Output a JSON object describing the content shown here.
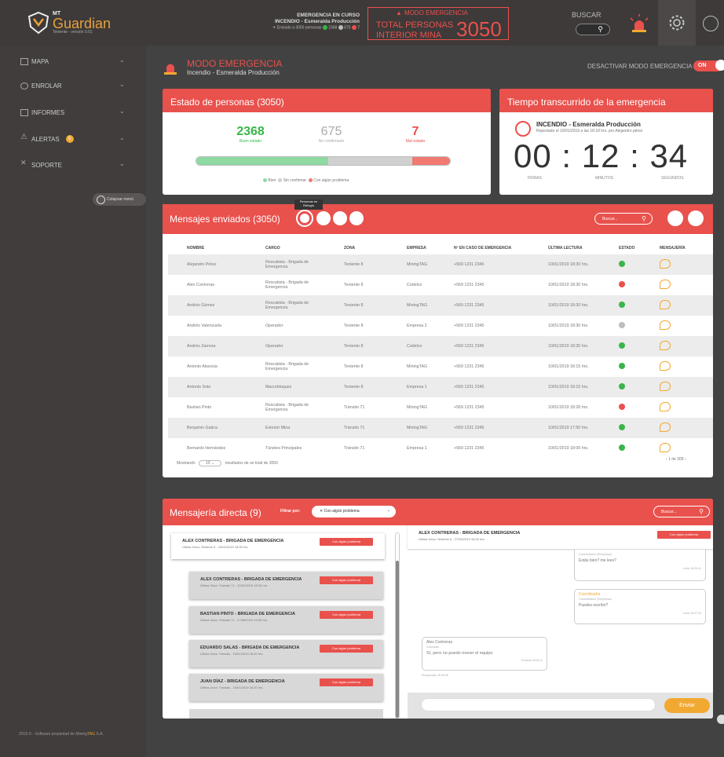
{
  "header": {
    "logo_mt": "MT",
    "logo_name": "Guardian",
    "logo_version": "Teniente - versión 0.01",
    "emergency_status": "EMERGENCIA EN CURSO",
    "emergency_name": "INCENDIO - Esmeralda Producción",
    "sent_text": "Enviado a 3050 personas",
    "count_good": "2368",
    "count_unconfirmed": "675",
    "count_bad": "7",
    "mode_label": "MODO EMERGENCIA",
    "total_line1": "TOTAL PERSONAS",
    "total_line2": "INTERIOR MINA",
    "total_number": "3050",
    "search_label": "BUSCAR"
  },
  "sidebar": {
    "items": [
      {
        "label": "MAPA"
      },
      {
        "label": "ENROLAR"
      },
      {
        "label": "INFORMES"
      },
      {
        "label": "ALERTAS",
        "badge": "5"
      },
      {
        "label": "SOPORTE"
      }
    ],
    "collapse_label": "Colapsar menú",
    "footer_prefix": "2019 © - Software propiedad de Mining",
    "footer_brand": "TAG",
    "footer_suffix": "S.A."
  },
  "mode": {
    "title": "MODO EMERGENCIA",
    "subtitle": "Incendio - Esmeralda Producción",
    "deactivate_label": "DESACTIVAR MODO EMERGENCIA",
    "toggle_label": "ON"
  },
  "estado": {
    "title": "Estado de personas (3050)",
    "good_value": "2368",
    "good_label": "Buen estado",
    "unconfirmed_value": "675",
    "unconfirmed_label": "No confirmado",
    "bad_value": "7",
    "bad_label": "Mal estado",
    "legend_good": "Bien",
    "legend_unconfirmed": "Sin confirmar",
    "legend_bad": "Con algún problema",
    "bar_fractions": {
      "good": 0.52,
      "unconfirmed": 0.33,
      "bad": 0.15
    },
    "colors": {
      "good": "#8fd9a3",
      "unconfirmed": "#d0d0d0",
      "bad": "#f07a72"
    }
  },
  "tiempo": {
    "title": "Tiempo transcurrido de la emergencia",
    "event_title": "INCENDIO - Esmeralda Producción",
    "event_sub": "Reportado el 10/01/2019 a las 18:18 hrs. por Alejandro pérez",
    "timer": "00 : 12 : 34",
    "label_hours": "HORAS",
    "label_minutes": "MINUTOS",
    "label_seconds": "SEGUNDOS"
  },
  "messages": {
    "title": "Mensajes enviados (3050)",
    "tooltip": "Personas en Refugio",
    "search_placeholder": "Buscar...",
    "columns": [
      "NOMBRE",
      "CARGO",
      "ZONA",
      "EMPRESA",
      "Nº EN CASO DE EMERGENCIA",
      "ÚLTIMA LECTURA",
      "ESTADO",
      "MENSAJERÍA"
    ],
    "rows": [
      {
        "nombre": "Alejandro Pérez",
        "cargo": "Rescatista - Brigada de Emergencia",
        "zona": "Teniente 8",
        "empresa": "MiningTAG",
        "tel": "+569 1231 2345",
        "lectura": "10/01/2019 18:30 hrs.",
        "estado": "ok"
      },
      {
        "nombre": "Alex Contreras",
        "cargo": "Rescatista - Brigada de Emergencia",
        "zona": "Teniente 8",
        "empresa": "Codelco",
        "tel": "+569 1231 2345",
        "lectura": "10/01/2019 18:30 hrs.",
        "estado": "bad"
      },
      {
        "nombre": "Andrés Gómez",
        "cargo": "Rescatista - Brigada de Emergencia",
        "zona": "Teniente 8",
        "empresa": "MiningTAG",
        "tel": "+569 1231 2345",
        "lectura": "10/01/2019 18:30 hrs.",
        "estado": "ok"
      },
      {
        "nombre": "Andrés Valenzuela",
        "cargo": "Operador",
        "zona": "Teniente 8",
        "empresa": "Empresa 2",
        "tel": "+569 1231 2345",
        "lectura": "10/01/2019 18:30 hrs.",
        "estado": "none"
      },
      {
        "nombre": "Andrés Zamora",
        "cargo": "Operador",
        "zona": "Teniente 8",
        "empresa": "Codelco",
        "tel": "+569 1231 2345",
        "lectura": "10/01/2019 18:30 hrs.",
        "estado": "ok"
      },
      {
        "nombre": "Antonio Abarzúa",
        "cargo": "Rescatista - Brigada de Emergencia",
        "zona": "Teniente 8",
        "empresa": "MiningTAG",
        "tel": "+569 1231 2345",
        "lectura": "10/01/2019 18:15 hrs.",
        "estado": "ok"
      },
      {
        "nombre": "Antonio Soto",
        "cargo": "Macrobloques",
        "zona": "Teniente 8",
        "empresa": "Empresa 1",
        "tel": "+569 1231 2345",
        "lectura": "10/01/2019 18:15 hrs.",
        "estado": "ok"
      },
      {
        "nombre": "Bastian Pinto",
        "cargo": "Rescatista - Brigada de Emergencia",
        "zona": "Tránsito 71",
        "empresa": "MiningTAG",
        "tel": "+569 1231 2345",
        "lectura": "10/01/2019 18:28 hrs.",
        "estado": "bad"
      },
      {
        "nombre": "Benjamin Gatica",
        "cargo": "Exterior Mina",
        "zona": "Tránsito 71",
        "empresa": "MiningTAG",
        "tel": "+569 1231 2345",
        "lectura": "10/01/2019 17:50 hrs.",
        "estado": "ok"
      },
      {
        "nombre": "Bernardo Hernández",
        "cargo": "Túneles Principales",
        "zona": "Tránsito 71",
        "empresa": "Empresa 1",
        "tel": "+569 1231 2345",
        "lectura": "10/01/2019 18:00 hrs.",
        "estado": "ok"
      }
    ],
    "showing_prefix": "Mostrando",
    "page_size": "10",
    "showing_suffix": "resultados de un total de 3050",
    "pagination": "1 de 305",
    "status_colors": {
      "ok": "#3ab54a",
      "bad": "#e9514d",
      "none": "#bdbdbd"
    }
  },
  "direct": {
    "title": "Mensajería directa (9)",
    "filter_label": "Filtrar por:",
    "filter_value": "Con algún problema",
    "search_placeholder": "Buscar...",
    "conversations": [
      {
        "name": "ALEX CONTRERAS - BRIGADA DE EMERGENCIA",
        "zone": "Última Zona: Teniente 8 - 10/01/2019 18:30 hrs.",
        "badge": "Con algún problema"
      },
      {
        "name": "ALEX CONTRERAS - BRIGADA DE EMERGENCIA",
        "zone": "Última Zona: Tránsito 71 - 10/01/2019 18:30 hrs.",
        "badge": "Con algún problema"
      },
      {
        "name": "BASTIAN PINTO - BRIGADA DE EMERGENCIA",
        "zone": "Última Zona: Tránsito 71 - 27/08/2019 19:00 hrs.",
        "badge": "Con algún problema"
      },
      {
        "name": "EDUARDO SALAS - BRIGADA DE EMERGENCIA",
        "zone": "Última Zona: Tránsito - 10/01/2019 18:30 hrs.",
        "badge": "Con algún problema"
      },
      {
        "name": "JUAN DÍAZ - BRIGADA DE EMERGENCIA",
        "zone": "Última Zona: Tránsito - 10/01/2019 18:30 hrs.",
        "badge": "Con algún problema"
      }
    ],
    "chat_header": {
      "name": "ALEX CONTRERAS - BRIGADA DE EMERGENCIA",
      "zone": "Última Zona: Teniente 8 - 27/05/2019 18:30 hrs.",
      "badge": "Con algún problema"
    },
    "chat": [
      {
        "from": "Coordinador (Empresa)",
        "text": "Estás bien? me lees?",
        "meta": "Leído 18:29:41"
      },
      {
        "from": "Coordinador",
        "sub": "Coordinador (Empresa)",
        "text": "Puedes escribir?",
        "meta": "Leído 18:27:44"
      },
      {
        "from": "Alex Contreras",
        "sub": "Contador",
        "text": "Sí, pero no puedo mover el equipo",
        "meta": "Enviado 18:30:11",
        "below": "Recuperado 18:28:38"
      }
    ],
    "send_label": "Enviar"
  }
}
